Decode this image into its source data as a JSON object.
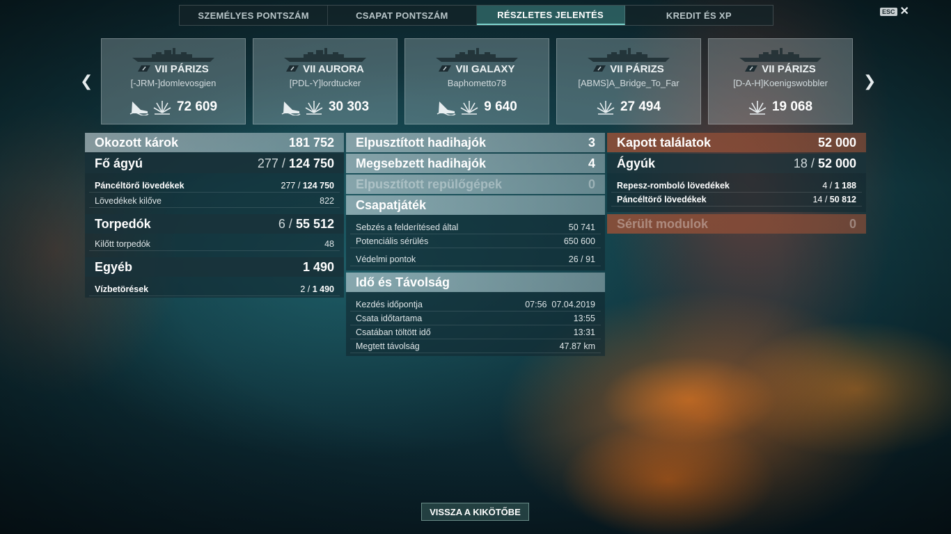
{
  "tabs": [
    {
      "label": "SZEMÉLYES PONTSZÁM",
      "active": false
    },
    {
      "label": "CSAPAT PONTSZÁM",
      "active": false
    },
    {
      "label": "RÉSZLETES JELENTÉS",
      "active": true
    },
    {
      "label": "KREDIT ÉS XP",
      "active": false
    }
  ],
  "esc_label": "ESC",
  "ships": [
    {
      "tier_name": "VII PÁRIZS",
      "player": "[-JRM-]domlevosgien",
      "damage": "72 609",
      "sunk_icon": true
    },
    {
      "tier_name": "VII AURORA",
      "player": "[PDL-Y]lordtucker",
      "damage": "30 303",
      "sunk_icon": true
    },
    {
      "tier_name": "VII GALAXY",
      "player": "Baphometto78",
      "damage": "9 640",
      "sunk_icon": true
    },
    {
      "tier_name": "VII PÁRIZS",
      "player": "[ABMS]A_Bridge_To_Far",
      "damage": "27 494",
      "sunk_icon": false
    },
    {
      "tier_name": "VII PÁRIZS",
      "player": "[D-A-H]Koenigswobbler",
      "damage": "19 068",
      "sunk_icon": false
    }
  ],
  "left": {
    "damage_caused": {
      "label": "Okozott károk",
      "value": "181 752"
    },
    "main_guns": {
      "label": "Fő ágyú",
      "hits": "277",
      "value": "124 750"
    },
    "ap_shells": {
      "label": "Páncéltörő lövedékek",
      "hits": "277",
      "value": "124 750"
    },
    "shells_fired": {
      "label": "Lövedékek kilőve",
      "value": "822"
    },
    "torpedoes": {
      "label": "Torpedók",
      "hits": "6",
      "value": "55 512"
    },
    "torps_fired": {
      "label": "Kilőtt torpedók",
      "value": "48"
    },
    "other": {
      "label": "Egyéb",
      "value": "1 490"
    },
    "flooding": {
      "label": "Vízbetörések",
      "hits": "2",
      "value": "1 490"
    }
  },
  "middle": {
    "destroyed": {
      "label": "Elpusztított hadihajók",
      "value": "3"
    },
    "damaged": {
      "label": "Megsebzett hadihajók",
      "value": "4"
    },
    "planes": {
      "label": "Elpusztított repülőgépek",
      "value": "0"
    },
    "teamplay": {
      "title": "Csapatjáték",
      "spotting": {
        "label": "Sebzés a felderítésed által",
        "value": "50 741"
      },
      "potential": {
        "label": "Potenciális sérülés",
        "value": "650 600"
      },
      "defense": {
        "label": "Védelmi pontok",
        "value": "26 / 91"
      }
    },
    "time": {
      "title": "Idő és Távolság",
      "start": {
        "label": "Kezdés időpontja",
        "value": "07:56  07.04.2019"
      },
      "duration": {
        "label": "Csata időtartama",
        "value": "13:55"
      },
      "in_battle": {
        "label": "Csatában töltött idő",
        "value": "13:31"
      },
      "distance": {
        "label": "Megtett távolság",
        "value": "47.87 km"
      }
    }
  },
  "right": {
    "received": {
      "label": "Kapott találatok",
      "value": "52 000"
    },
    "guns": {
      "label": "Ágyúk",
      "hits": "18",
      "value": "52 000"
    },
    "he": {
      "label": "Repesz-romboló lövedékek",
      "hits": "4",
      "value": "1 188"
    },
    "ap": {
      "label": "Páncéltörő lövedékek",
      "hits": "14",
      "value": "50 812"
    },
    "modules": {
      "label": "Sérült modulok",
      "value": "0"
    }
  },
  "back_button": "VISSZA A KIKÖTŐBE"
}
